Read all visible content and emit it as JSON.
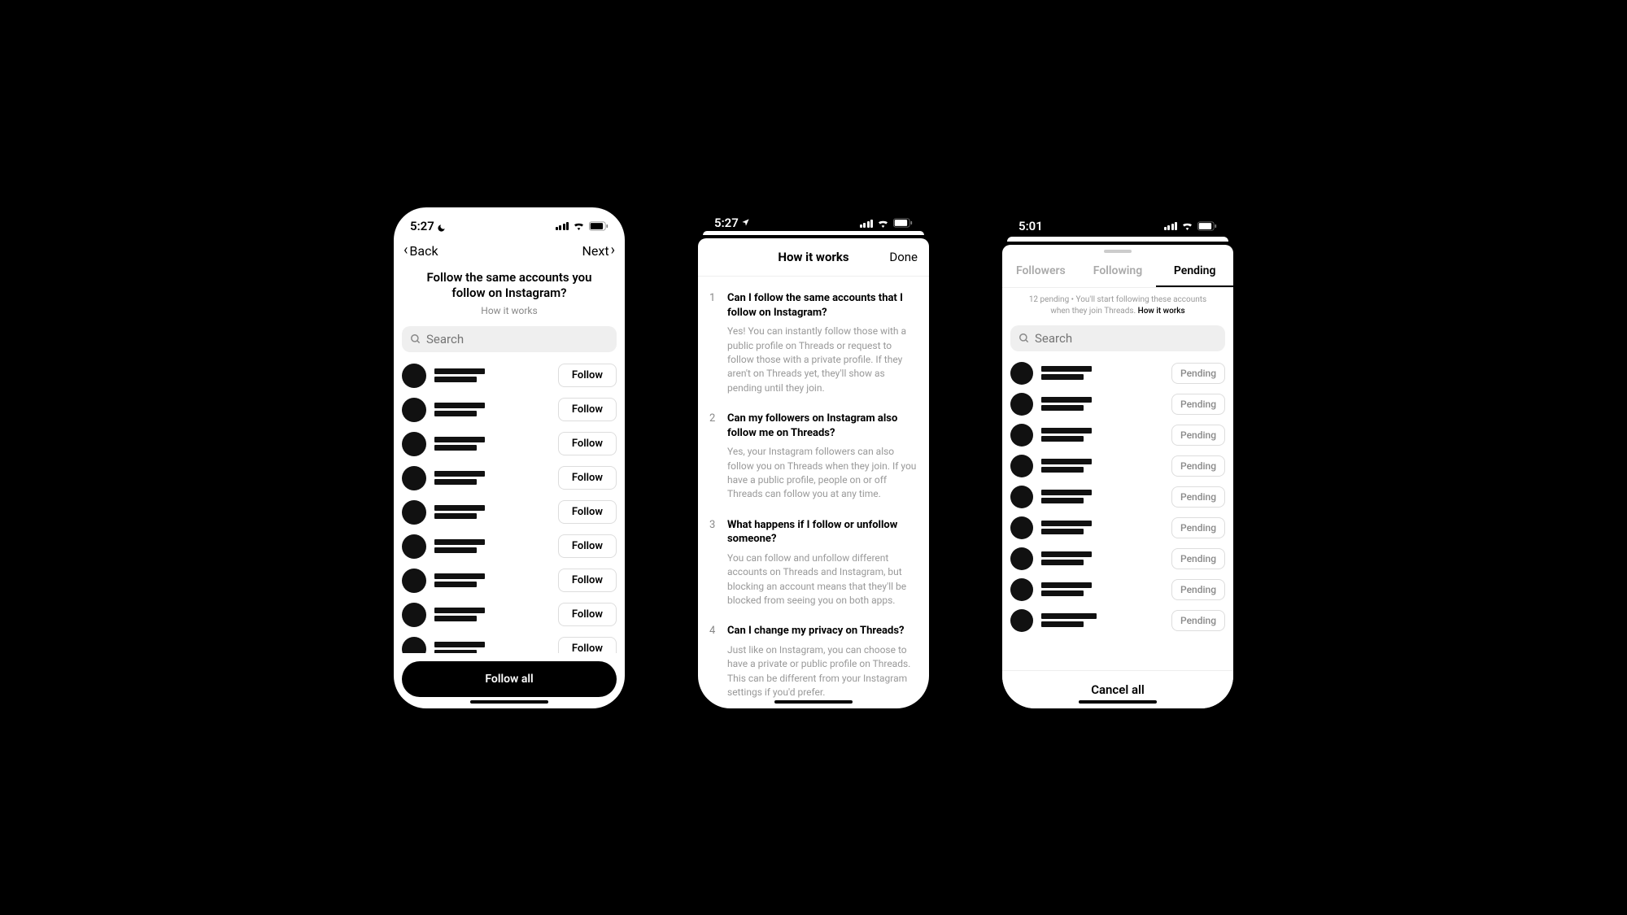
{
  "screen1": {
    "status_time": "5:27",
    "nav_back": "Back",
    "nav_next": "Next",
    "title": "Follow the same accounts you follow on Instagram?",
    "subtitle": "How it works",
    "search_placeholder": "Search",
    "follow_label": "Follow",
    "follow_all": "Follow all"
  },
  "screen2": {
    "status_time": "5:27",
    "modal_title": "How it works",
    "done": "Done",
    "faq": [
      {
        "num": "1",
        "q": "Can I follow the same accounts that I follow on Instagram?",
        "a": "Yes! You can instantly follow those with a public profile on Threads or request to follow those with a private profile. If they aren't on Threads yet, they'll show as pending until they join."
      },
      {
        "num": "2",
        "q": "Can my followers on Instagram also follow me on Threads?",
        "a": "Yes, your Instagram followers can also follow you on Threads when they join. If you have a public profile, people on or off Threads can follow you at any time."
      },
      {
        "num": "3",
        "q": "What happens if I follow or unfollow someone?",
        "a": "You can follow and unfollow different accounts on Threads and Instagram, but blocking an account means that they'll be blocked from seeing you on both apps."
      },
      {
        "num": "4",
        "q": "Can I change my privacy on Threads?",
        "a": "Just like on Instagram, you can choose to have a private or public profile on Threads. This can be different from your Instagram settings if you'd prefer."
      }
    ]
  },
  "screen3": {
    "status_time": "5:01",
    "tabs": {
      "followers": "Followers",
      "following": "Following",
      "pending": "Pending"
    },
    "info_prefix": "12 pending • You'll start following these accounts when they join Threads. ",
    "info_link": "How it works",
    "search_placeholder": "Search",
    "pending_label": "Pending",
    "cancel_all": "Cancel all"
  }
}
